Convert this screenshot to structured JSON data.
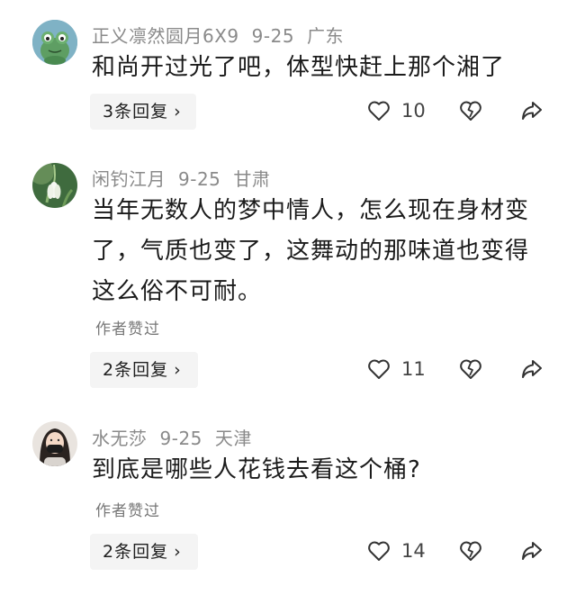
{
  "comments": [
    {
      "username": "正义凛然圆月6X9",
      "date": "9-25",
      "location": "广东",
      "text": "和尚开过光了吧，体型快赶上那个湘了",
      "author_liked": "",
      "reply_label": "3条回复",
      "likes": "10",
      "avatar_icon": "frog-avatar"
    },
    {
      "username": "闲钓江月",
      "date": "9-25",
      "location": "甘肃",
      "text": "当年无数人的梦中情人，怎么现在身材变了，气质也变了，这舞动的那味道也变得这么俗不可耐。",
      "author_liked": "作者赞过",
      "reply_label": "2条回复",
      "likes": "11",
      "avatar_icon": "snowdrop-flower-avatar"
    },
    {
      "username": "水无莎",
      "date": "9-25",
      "location": "天津",
      "text": "到底是哪些人花钱去看这个桶?",
      "author_liked": "作者赞过",
      "reply_label": "2条回复",
      "likes": "14",
      "avatar_icon": "masked-person-avatar"
    }
  ],
  "icons": {
    "like": "heart-outline-icon",
    "dislike": "broken-heart-icon",
    "share": "share-arrow-icon",
    "reply_chevron": "chevron-right-icon"
  },
  "colors": {
    "meta_text": "#8a8a8a",
    "reply_button_bg": "#f4f4f4",
    "body_text": "#1b1b1b"
  }
}
